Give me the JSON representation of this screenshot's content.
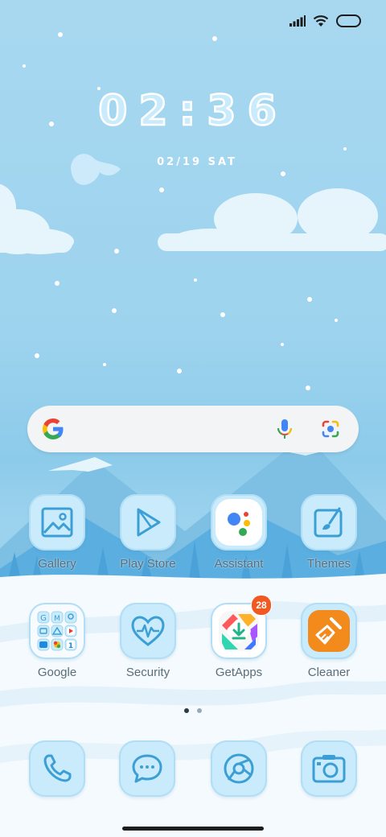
{
  "status_bar": {
    "icons": [
      "signal-icon",
      "wifi-icon",
      "battery-icon"
    ]
  },
  "lock_clock": {
    "time": "02:36",
    "date": "02/19 SAT"
  },
  "search_bar": {
    "icons": [
      "google-logo-icon",
      "microphone-icon",
      "google-lens-icon"
    ]
  },
  "apps": [
    {
      "label": "Gallery",
      "icon": "gallery-icon"
    },
    {
      "label": "Play Store",
      "icon": "play-store-icon"
    },
    {
      "label": "Assistant",
      "icon": "assistant-icon"
    },
    {
      "label": "Themes",
      "icon": "themes-icon"
    },
    {
      "label": "Google",
      "icon": "google-folder-icon"
    },
    {
      "label": "Security",
      "icon": "security-icon"
    },
    {
      "label": "GetApps",
      "icon": "getapps-icon",
      "badge": "28"
    },
    {
      "label": "Cleaner",
      "icon": "cleaner-icon"
    }
  ],
  "pages": {
    "count": 2,
    "current": 1
  },
  "dock": [
    {
      "icon": "phone-icon"
    },
    {
      "icon": "messages-icon"
    },
    {
      "icon": "browser-icon"
    },
    {
      "icon": "camera-icon"
    }
  ],
  "colors": {
    "accent": "#3b9fd6",
    "icon_tile": "#c9ebfb",
    "badge": "#f05a22",
    "sky": "#a8d8f0"
  }
}
